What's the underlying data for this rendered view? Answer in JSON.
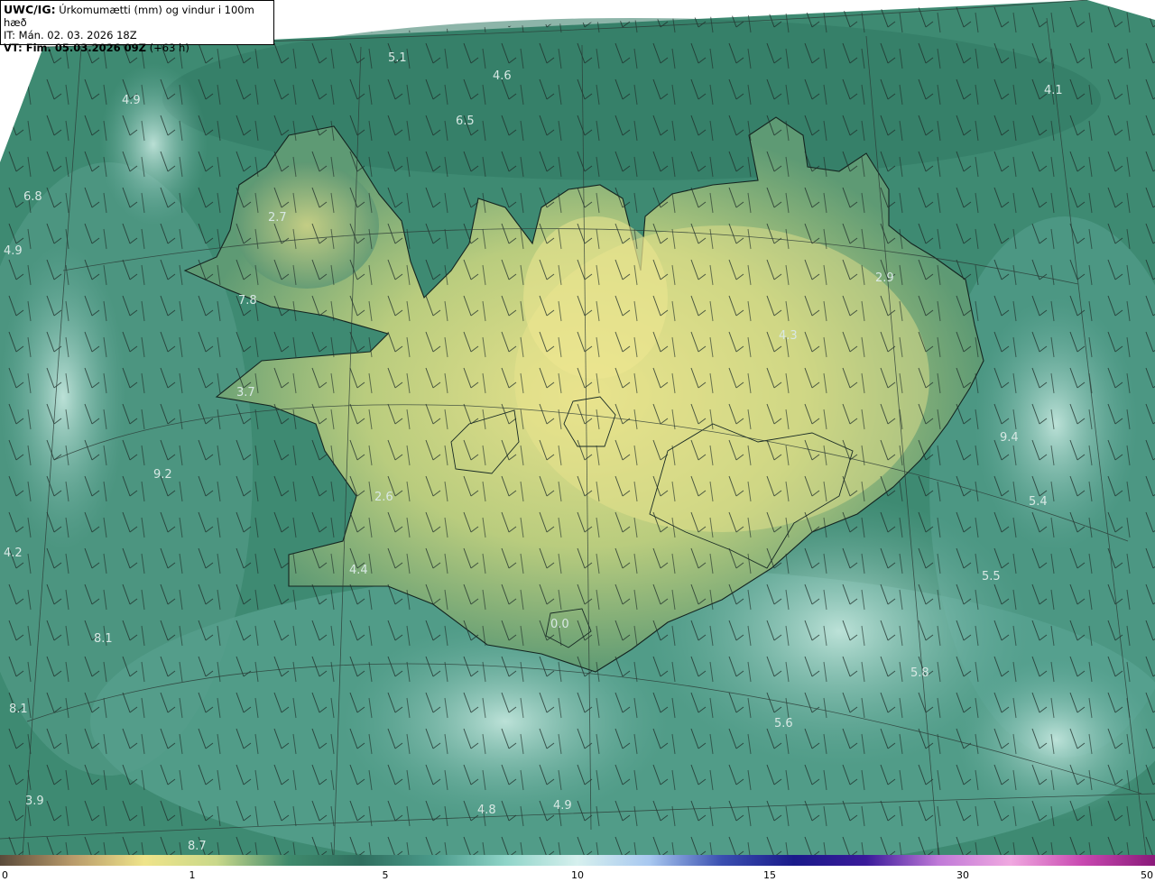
{
  "header": {
    "line1_bold": "UWC/IG:",
    "line1_text": " Úrkomumætti (mm) og vindur i 100m hæð",
    "line2": "IT: Mán. 02. 03. 2026 18Z",
    "line3_bold": "VT: Fim. 05.03.2026 09Z",
    "line3_text": " (+63 h)"
  },
  "map_labels": [
    "5.1",
    "4.6",
    "4.1",
    "4.9",
    "6.5",
    "6.8",
    "4.9",
    "2.7",
    "7.8",
    "3.7",
    "4.3",
    "2.9",
    "9.2",
    "5.4",
    "4.2",
    "4.4",
    "5.5",
    "8.1",
    "5.8",
    "8.1",
    "5.6",
    "3.9",
    "4.8",
    "4.9",
    "8.7",
    "0.0",
    "9.4",
    "2.6"
  ],
  "colorbar": {
    "ticks": [
      "0",
      "1",
      "5",
      "10",
      "15",
      "30",
      "50"
    ],
    "colors": [
      "#5a4a3a",
      "#b89a6a",
      "#efe48a",
      "#c9d88a",
      "#3f8a6c",
      "#2f6e5e",
      "#4a9a8a",
      "#8fd4c8",
      "#d6f0ee",
      "#a8c8f0",
      "#3a4fb0",
      "#1a1a8a",
      "#3a1a9a",
      "#c07ad8",
      "#f0a8e0",
      "#c848b0",
      "#8a1a7a"
    ]
  }
}
